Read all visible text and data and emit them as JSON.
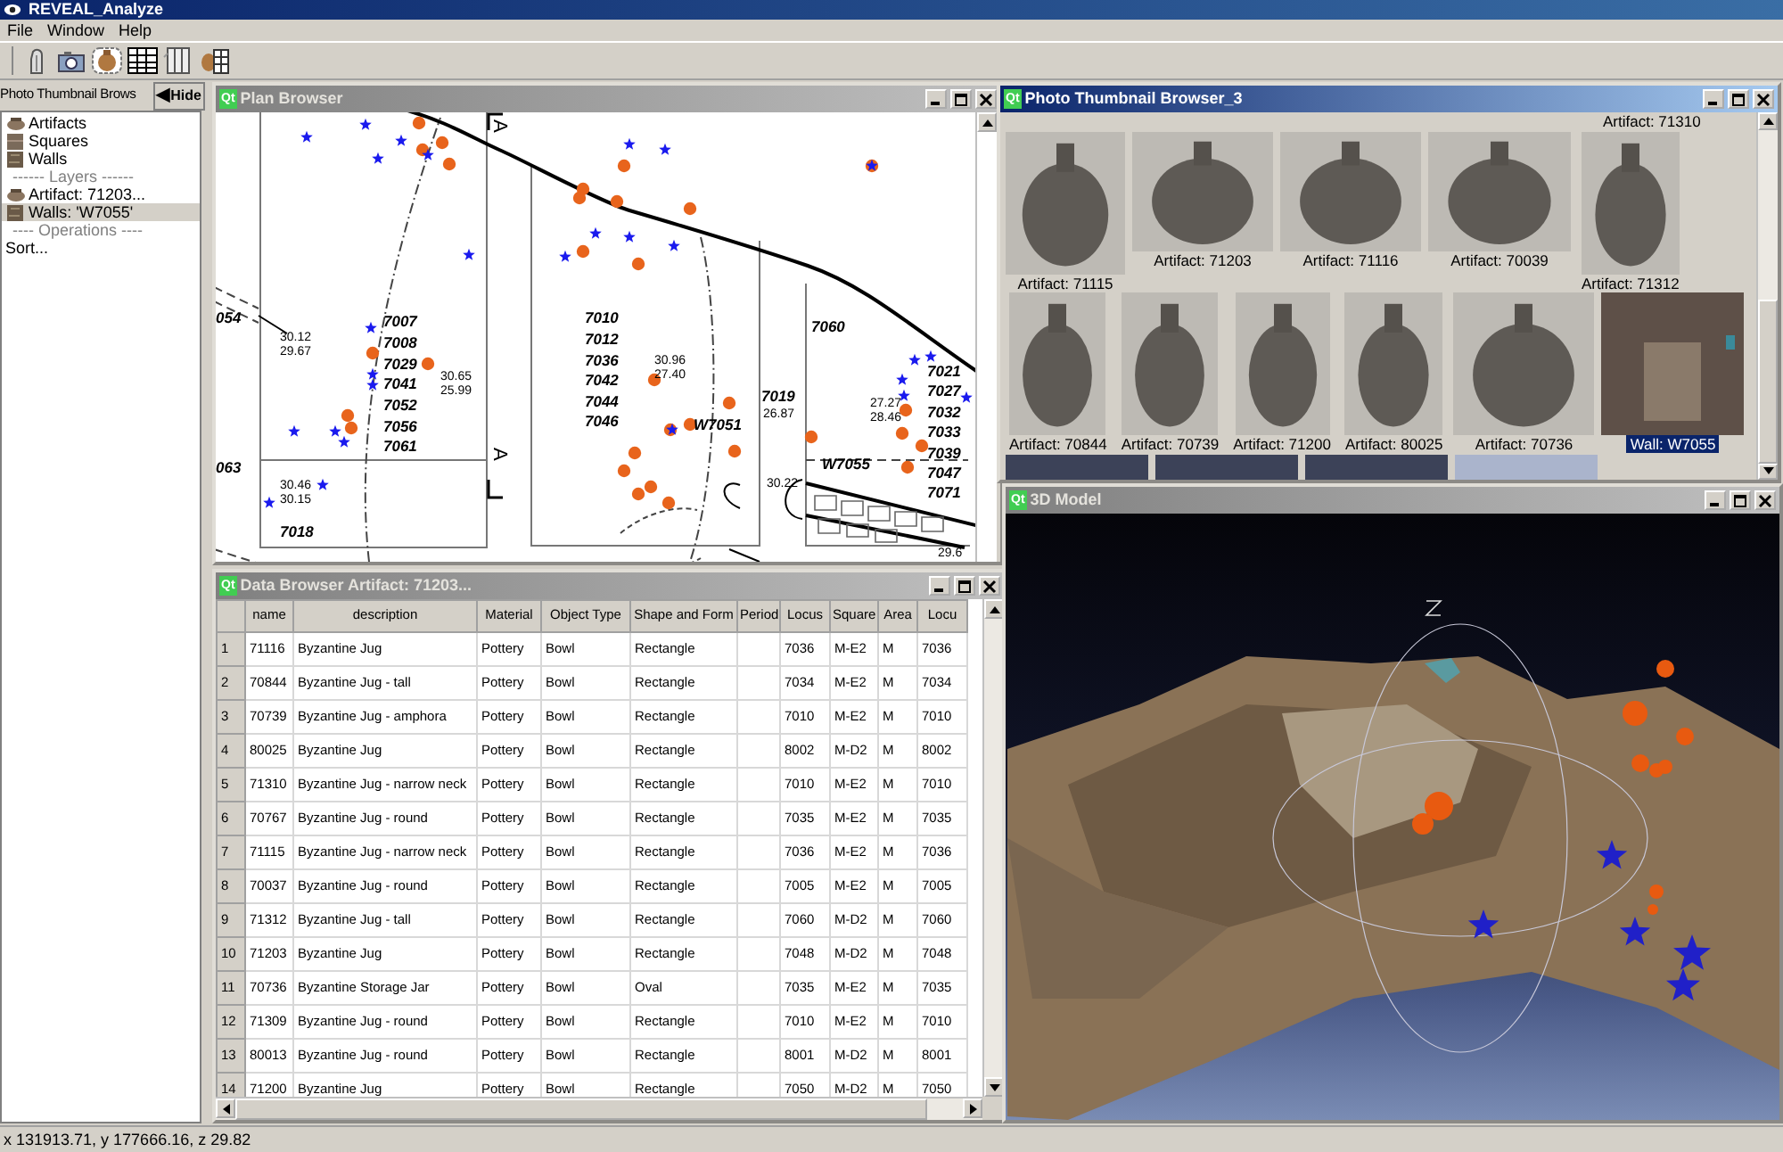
{
  "window": {
    "title": "REVEAL_Analyze"
  },
  "menu": [
    "File",
    "Window",
    "Help"
  ],
  "side_panel": {
    "tab_label": "Photo Thumbnail Brows",
    "hide_glyph": "◀",
    "hide_button": "Hide",
    "items": [
      {
        "kind": "artifact",
        "label": "Artifacts",
        "selected": false
      },
      {
        "kind": "square",
        "label": "Squares",
        "selected": false
      },
      {
        "kind": "wall",
        "label": "Walls",
        "selected": false
      },
      {
        "kind": "heading",
        "label": "------ Layers ------",
        "selected": false
      },
      {
        "kind": "artifact",
        "label": "Artifact: 71203...",
        "selected": false
      },
      {
        "kind": "wall",
        "label": "Walls: 'W7055'",
        "selected": true
      },
      {
        "kind": "heading",
        "label": "---- Operations ----",
        "selected": false
      },
      {
        "kind": "action",
        "label": "Sort...",
        "selected": false
      }
    ]
  },
  "plan_browser": {
    "logo": "Qt",
    "title": "Plan Browser",
    "active": false,
    "section_marks": [
      "A",
      "A"
    ],
    "labels": [
      "054",
      "30.12",
      "29.67",
      "7007",
      "7008",
      "7029",
      "7041",
      "7052",
      "7056",
      "7061",
      "30.65",
      "25.99",
      "063",
      "30.46",
      "30.15",
      "7018",
      "7010",
      "7012",
      "7036",
      "7042",
      "7044",
      "7046",
      "30.96",
      "27.40",
      "7019",
      "26.87",
      "W7051",
      "30.22",
      "7060",
      "27.27",
      "28.46",
      "W7055",
      "7021",
      "7027",
      "7032",
      "7033",
      "7039",
      "7047",
      "7071",
      "29.6"
    ]
  },
  "photo_browser": {
    "logo": "Qt",
    "title": "Photo Thumbnail Browser_3",
    "active": true,
    "top_caption": "Artifact: 71310",
    "strips": [
      {
        "items": [
          {
            "kind": "artifact",
            "caption": "Artifact: 71115",
            "selected": false
          },
          {
            "kind": "artifact",
            "caption": "Artifact: 71203",
            "selected": false
          },
          {
            "kind": "artifact",
            "caption": "Artifact: 71116",
            "selected": false
          },
          {
            "kind": "artifact",
            "caption": "Artifact: 70039",
            "selected": false
          },
          {
            "kind": "artifact",
            "caption": "Artifact: 71312",
            "selected": false
          }
        ]
      },
      {
        "items": [
          {
            "kind": "artifact",
            "caption": "Artifact: 70844",
            "selected": false
          },
          {
            "kind": "artifact",
            "caption": "Artifact: 70739",
            "selected": false
          },
          {
            "kind": "artifact",
            "caption": "Artifact: 71200",
            "selected": false
          },
          {
            "kind": "artifact",
            "caption": "Artifact: 80025",
            "selected": false
          },
          {
            "kind": "artifact",
            "caption": "Artifact: 70736",
            "selected": false
          },
          {
            "kind": "wall",
            "caption": "Wall: W7055",
            "selected": true
          }
        ]
      }
    ]
  },
  "data_browser": {
    "logo": "Qt",
    "title": "Data Browser Artifact: 71203...",
    "active": false,
    "columns": [
      "name",
      "description",
      "Material",
      "Object Type",
      "Shape and Form",
      "Period",
      "Locus",
      "Square",
      "Area",
      "Locu"
    ],
    "rows": [
      {
        "num": "1",
        "cells": {
          "name": "71116",
          "description": "Byzantine Jug",
          "material": "Pottery",
          "object_type": "Bowl",
          "shape": "Rectangle",
          "locus": "7036",
          "square": "M-E2",
          "area": "M",
          "column_10": "7036"
        }
      },
      {
        "num": "2",
        "cells": {
          "name": "70844",
          "description": "Byzantine Jug - tall",
          "material": "Pottery",
          "object_type": "Bowl",
          "shape": "Rectangle",
          "locus": "7034",
          "square": "M-E2",
          "area": "M",
          "column_10": "7034"
        }
      },
      {
        "num": "3",
        "cells": {
          "name": "70739",
          "description": "Byzantine Jug - amphora",
          "material": "Pottery",
          "object_type": "Bowl",
          "shape": "Rectangle",
          "locus": "7010",
          "square": "M-E2",
          "area": "M",
          "column_10": "7010"
        }
      },
      {
        "num": "4",
        "cells": {
          "name": "80025",
          "description": "Byzantine Jug",
          "material": "Pottery",
          "object_type": "Bowl",
          "shape": "Rectangle",
          "locus": "8002",
          "square": "M-D2",
          "area": "M",
          "column_10": "8002"
        }
      },
      {
        "num": "5",
        "cells": {
          "name": "71310",
          "description": "Byzantine Jug - narrow neck",
          "material": "Pottery",
          "object_type": "Bowl",
          "shape": "Rectangle",
          "locus": "7010",
          "square": "M-E2",
          "area": "M",
          "column_10": "7010"
        }
      },
      {
        "num": "6",
        "cells": {
          "name": "70767",
          "description": "Byzantine Jug - round",
          "material": "Pottery",
          "object_type": "Bowl",
          "shape": "Rectangle",
          "locus": "7035",
          "square": "M-E2",
          "area": "M",
          "column_10": "7035"
        }
      },
      {
        "num": "7",
        "cells": {
          "name": "71115",
          "description": "Byzantine Jug - narrow neck",
          "material": "Pottery",
          "object_type": "Bowl",
          "shape": "Rectangle",
          "locus": "7036",
          "square": "M-E2",
          "area": "M",
          "column_10": "7036"
        }
      },
      {
        "num": "8",
        "cells": {
          "name": "70037",
          "description": "Byzantine Jug - round",
          "material": "Pottery",
          "object_type": "Bowl",
          "shape": "Rectangle",
          "locus": "7005",
          "square": "M-E2",
          "area": "M",
          "column_10": "7005"
        }
      },
      {
        "num": "9",
        "cells": {
          "name": "71312",
          "description": "Byzantine Jug - tall",
          "material": "Pottery",
          "object_type": "Bowl",
          "shape": "Rectangle",
          "locus": "7060",
          "square": "M-D2",
          "area": "M",
          "column_10": "7060"
        }
      },
      {
        "num": "10",
        "cells": {
          "name": "71203",
          "description": "Byzantine Jug",
          "material": "Pottery",
          "object_type": "Bowl",
          "shape": "Rectangle",
          "locus": "7048",
          "square": "M-D2",
          "area": "M",
          "column_10": "7048"
        }
      },
      {
        "num": "11",
        "cells": {
          "name": "70736",
          "description": "Byzantine Storage Jar",
          "material": "Pottery",
          "object_type": "Bowl",
          "shape": "Oval",
          "locus": "7035",
          "square": "M-E2",
          "area": "M",
          "column_10": "7035"
        }
      },
      {
        "num": "12",
        "cells": {
          "name": "71309",
          "description": "Byzantine Jug - round",
          "material": "Pottery",
          "object_type": "Bowl",
          "shape": "Rectangle",
          "locus": "7010",
          "square": "M-E2",
          "area": "M",
          "column_10": "7010"
        }
      },
      {
        "num": "13",
        "cells": {
          "name": "80013",
          "description": "Byzantine Jug - round",
          "material": "Pottery",
          "object_type": "Bowl",
          "shape": "Rectangle",
          "locus": "8001",
          "square": "M-D2",
          "area": "M",
          "column_10": "8001"
        }
      },
      {
        "num": "14",
        "cells": {
          "name": "71200",
          "description": "Byzantine Jug",
          "material": "Pottery",
          "object_type": "Bowl",
          "shape": "Rectangle",
          "locus": "7050",
          "square": "M-D2",
          "area": "M",
          "column_10": "7050"
        }
      }
    ]
  },
  "model_view": {
    "logo": "Qt",
    "title": "3D Model",
    "active": false
  },
  "status_bar": "x 131913.71, y 177666.16, z 29.82"
}
